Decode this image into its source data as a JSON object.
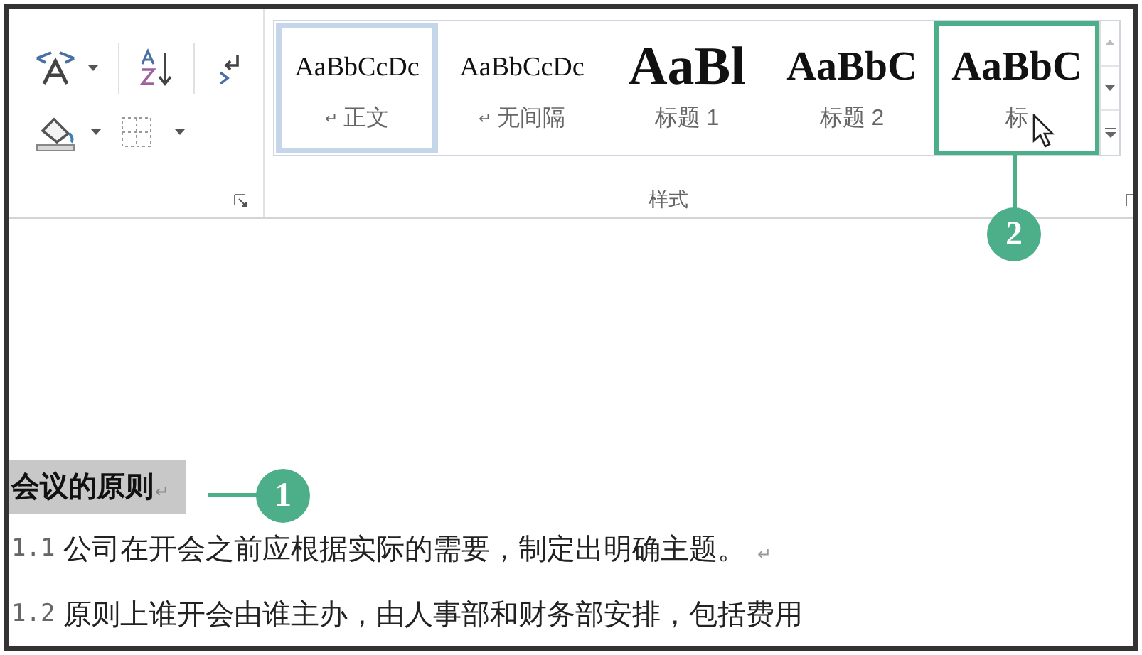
{
  "ribbon": {
    "styles": [
      {
        "kind": "body",
        "preview": "AaBbCcDc",
        "mark": "↵",
        "label": "正文",
        "selected": true,
        "hovered": false
      },
      {
        "kind": "body",
        "preview": "AaBbCcDc",
        "mark": "↵",
        "label": "无间隔",
        "selected": false,
        "hovered": false
      },
      {
        "kind": "heading1",
        "preview": "AaBl",
        "label": "标题 1",
        "selected": false,
        "hovered": false
      },
      {
        "kind": "heading2",
        "preview": "AaBbC",
        "label": "标题 2",
        "selected": false,
        "hovered": false
      },
      {
        "kind": "heading2",
        "preview": "AaBbC",
        "label": "标",
        "selected": false,
        "hovered": true
      }
    ],
    "group_label": "样式"
  },
  "callouts": [
    {
      "number": "2"
    },
    {
      "number": "1"
    }
  ],
  "document": {
    "heading": {
      "text": "会议的原则",
      "end_mark": "↵",
      "selected": true
    },
    "paragraphs": [
      {
        "number": "1.1",
        "text": "公司在开会之前应根据实际的需要，制定出明确主题。",
        "end_mark": "↵"
      },
      {
        "number": "1.2",
        "text": "原则上谁开会由谁主办，由人事部和财务部安排，包括费用"
      }
    ]
  }
}
